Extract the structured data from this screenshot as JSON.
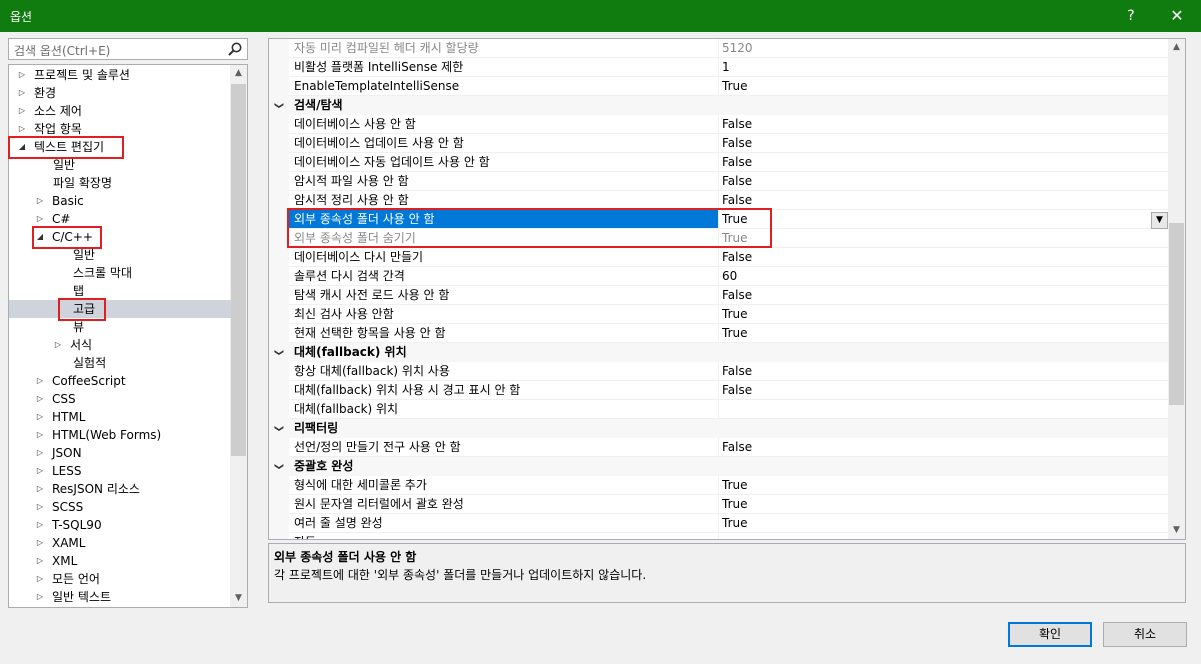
{
  "window": {
    "title": "옵션",
    "help": "?",
    "close": "✕"
  },
  "search": {
    "placeholder": "검색 옵션(Ctrl+E)"
  },
  "tree": [
    {
      "label": "프로젝트 및 솔루션",
      "arrow": "▷"
    },
    {
      "label": "환경",
      "arrow": "▷"
    },
    {
      "label": "소스 제어",
      "arrow": "▷"
    },
    {
      "label": "작업 항목",
      "arrow": "▷"
    },
    {
      "label": "텍스트 편집기",
      "arrow": "◢"
    },
    {
      "label": "일반",
      "arrow": ""
    },
    {
      "label": "파일 확장명",
      "arrow": ""
    },
    {
      "label": "Basic",
      "arrow": "▷"
    },
    {
      "label": "C#",
      "arrow": "▷"
    },
    {
      "label": "C/C++",
      "arrow": "◢"
    },
    {
      "label": "일반",
      "arrow": ""
    },
    {
      "label": "스크롤 막대",
      "arrow": ""
    },
    {
      "label": "탭",
      "arrow": ""
    },
    {
      "label": "고급",
      "arrow": "",
      "selected": true
    },
    {
      "label": "뷰",
      "arrow": ""
    },
    {
      "label": "서식",
      "arrow": "▷"
    },
    {
      "label": "실험적",
      "arrow": ""
    },
    {
      "label": "CoffeeScript",
      "arrow": "▷"
    },
    {
      "label": "CSS",
      "arrow": "▷"
    },
    {
      "label": "HTML",
      "arrow": "▷"
    },
    {
      "label": "HTML(Web Forms)",
      "arrow": "▷"
    },
    {
      "label": "JSON",
      "arrow": "▷"
    },
    {
      "label": "LESS",
      "arrow": "▷"
    },
    {
      "label": "ResJSON 리소스",
      "arrow": "▷"
    },
    {
      "label": "SCSS",
      "arrow": "▷"
    },
    {
      "label": "T-SQL90",
      "arrow": "▷"
    },
    {
      "label": "XAML",
      "arrow": "▷"
    },
    {
      "label": "XML",
      "arrow": "▷"
    },
    {
      "label": "모든 언어",
      "arrow": "▷"
    },
    {
      "label": "일반 텍스트",
      "arrow": "▷"
    }
  ],
  "grid": [
    {
      "type": "prop",
      "name": "자동 미리 컴파일된 헤더 캐시 할당량",
      "value": "5120",
      "dim": true
    },
    {
      "type": "prop",
      "name": "비활성 플랫폼 IntelliSense 제한",
      "value": "1"
    },
    {
      "type": "prop",
      "name": "EnableTemplateIntelliSense",
      "value": "True"
    },
    {
      "type": "cat",
      "name": "검색/탐색"
    },
    {
      "type": "prop",
      "name": "데이터베이스 사용 안 함",
      "value": "False"
    },
    {
      "type": "prop",
      "name": "데이터베이스 업데이트 사용 안 함",
      "value": "False"
    },
    {
      "type": "prop",
      "name": "데이터베이스 자동 업데이트 사용 안 함",
      "value": "False"
    },
    {
      "type": "prop",
      "name": "암시적 파일 사용 안 함",
      "value": "False"
    },
    {
      "type": "prop",
      "name": "암시적 정리 사용 안 함",
      "value": "False"
    },
    {
      "type": "prop",
      "name": "외부 종속성 폴더 사용 안 함",
      "value": "True",
      "selected": true
    },
    {
      "type": "prop",
      "name": "외부 종속성 폴더 숨기기",
      "value": "True",
      "dim": true
    },
    {
      "type": "prop",
      "name": "데이터베이스 다시 만들기",
      "value": "False"
    },
    {
      "type": "prop",
      "name": "솔루션 다시 검색 간격",
      "value": "60"
    },
    {
      "type": "prop",
      "name": "탐색 캐시 사전 로드 사용 안 함",
      "value": "False"
    },
    {
      "type": "prop",
      "name": "최신 검사 사용 안함",
      "value": "True"
    },
    {
      "type": "prop",
      "name": "현재 선택한 항목을 사용 안 함",
      "value": "True"
    },
    {
      "type": "cat",
      "name": "대체(fallback) 위치"
    },
    {
      "type": "prop",
      "name": "항상 대체(fallback) 위치 사용",
      "value": "False"
    },
    {
      "type": "prop",
      "name": "대체(fallback) 위치 사용 시 경고 표시 안 함",
      "value": "False"
    },
    {
      "type": "prop",
      "name": "대체(fallback) 위치",
      "value": ""
    },
    {
      "type": "cat",
      "name": "리팩터링"
    },
    {
      "type": "prop",
      "name": "선언/정의 만들기 전구 사용 안 함",
      "value": "False"
    },
    {
      "type": "cat",
      "name": "중괄호 완성"
    },
    {
      "type": "prop",
      "name": "형식에 대한 세미콜론 추가",
      "value": "True"
    },
    {
      "type": "prop",
      "name": "원시 문자열 리터럴에서 괄호 완성",
      "value": "True"
    },
    {
      "type": "prop",
      "name": "여러 줄 설명 완성",
      "value": "True"
    },
    {
      "type": "prop",
      "name": "자동 ...",
      "value": ""
    }
  ],
  "description": {
    "title": "외부 종속성 폴더 사용 안 함",
    "text": "각 프로젝트에 대한 '외부 종속성' 폴더를 만들거나 업데이트하지 않습니다."
  },
  "buttons": {
    "ok": "확인",
    "cancel": "취소"
  },
  "colors": {
    "titlebar": "#107c10",
    "selection": "#0078d7",
    "highlight_box": "#e02020"
  }
}
